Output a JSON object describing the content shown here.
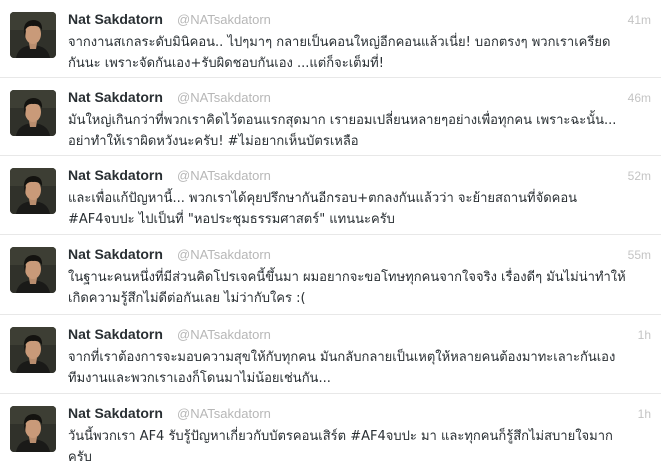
{
  "tweets": [
    {
      "name": "Nat Sakdatorn",
      "handle": "@NATsakdatorn",
      "time": "41m",
      "lines": [
        "จากงานสเกลระดับมินิคอน.. ไปๆมาๆ กลายเป็นคอนใหญ่อีกคอนแล้วเนี่ย! บอกตรงๆ พวกเราเครียด",
        "กันนะ เพราะจัดกันเอง+รับผิดชอบกันเอง ...แต่ก็จะเต็มที่!"
      ]
    },
    {
      "name": "Nat Sakdatorn",
      "handle": "@NATsakdatorn",
      "time": "46m",
      "lines": [
        "มันใหญ่เกินกว่าที่พวกเราคิดไว้ตอนแรกสุดมาก เรายอมเปลี่ยนหลายๆอย่างเพื่อทุกคน เพราะฉะนั้น...",
        "อย่าทำให้เราผิดหวังนะครับ! #ไม่อยากเห็นบัตรเหลือ"
      ]
    },
    {
      "name": "Nat Sakdatorn",
      "handle": "@NATsakdatorn",
      "time": "52m",
      "lines": [
        "และเพื่อแก้ปัญหานี้... พวกเราได้คุยปรึกษากันอีกรอบ+ตกลงกันแล้วว่า จะย้ายสถานที่จัดคอน",
        "#AF4จบปะ ไปเป็นที่ \"หอประชุมธรรมศาสตร์\" แทนนะครับ"
      ]
    },
    {
      "name": "Nat Sakdatorn",
      "handle": "@NATsakdatorn",
      "time": "55m",
      "lines": [
        "ในฐานะคนหนึ่งที่มีส่วนคิดโปรเจคนี้ขึ้นมา ผมอยากจะขอโทษทุกคนจากใจจริง เรื่องดีๆ มันไม่น่าทำให้",
        "เกิดความรู้สึกไม่ดีต่อกันเลย ไม่ว่ากับใคร :("
      ]
    },
    {
      "name": "Nat Sakdatorn",
      "handle": "@NATsakdatorn",
      "time": "1h",
      "lines": [
        "จากที่เราต้องการจะมอบความสุขให้กับทุกคน มันกลับกลายเป็นเหตุให้หลายคนต้องมาทะเลาะกันเอง",
        "ทีมงานและพวกเราเองก็โดนมาไม่น้อยเช่นกัน..."
      ]
    },
    {
      "name": "Nat Sakdatorn",
      "handle": "@NATsakdatorn",
      "time": "1h",
      "lines": [
        "วันนี้พวกเรา AF4 รับรู้ปัญหาเกี่ยวกับบัตรคอนเสิร์ต #AF4จบปะ มา และทุกคนก็รู้สึกไม่สบายใจมาก",
        "ครับ"
      ]
    }
  ]
}
